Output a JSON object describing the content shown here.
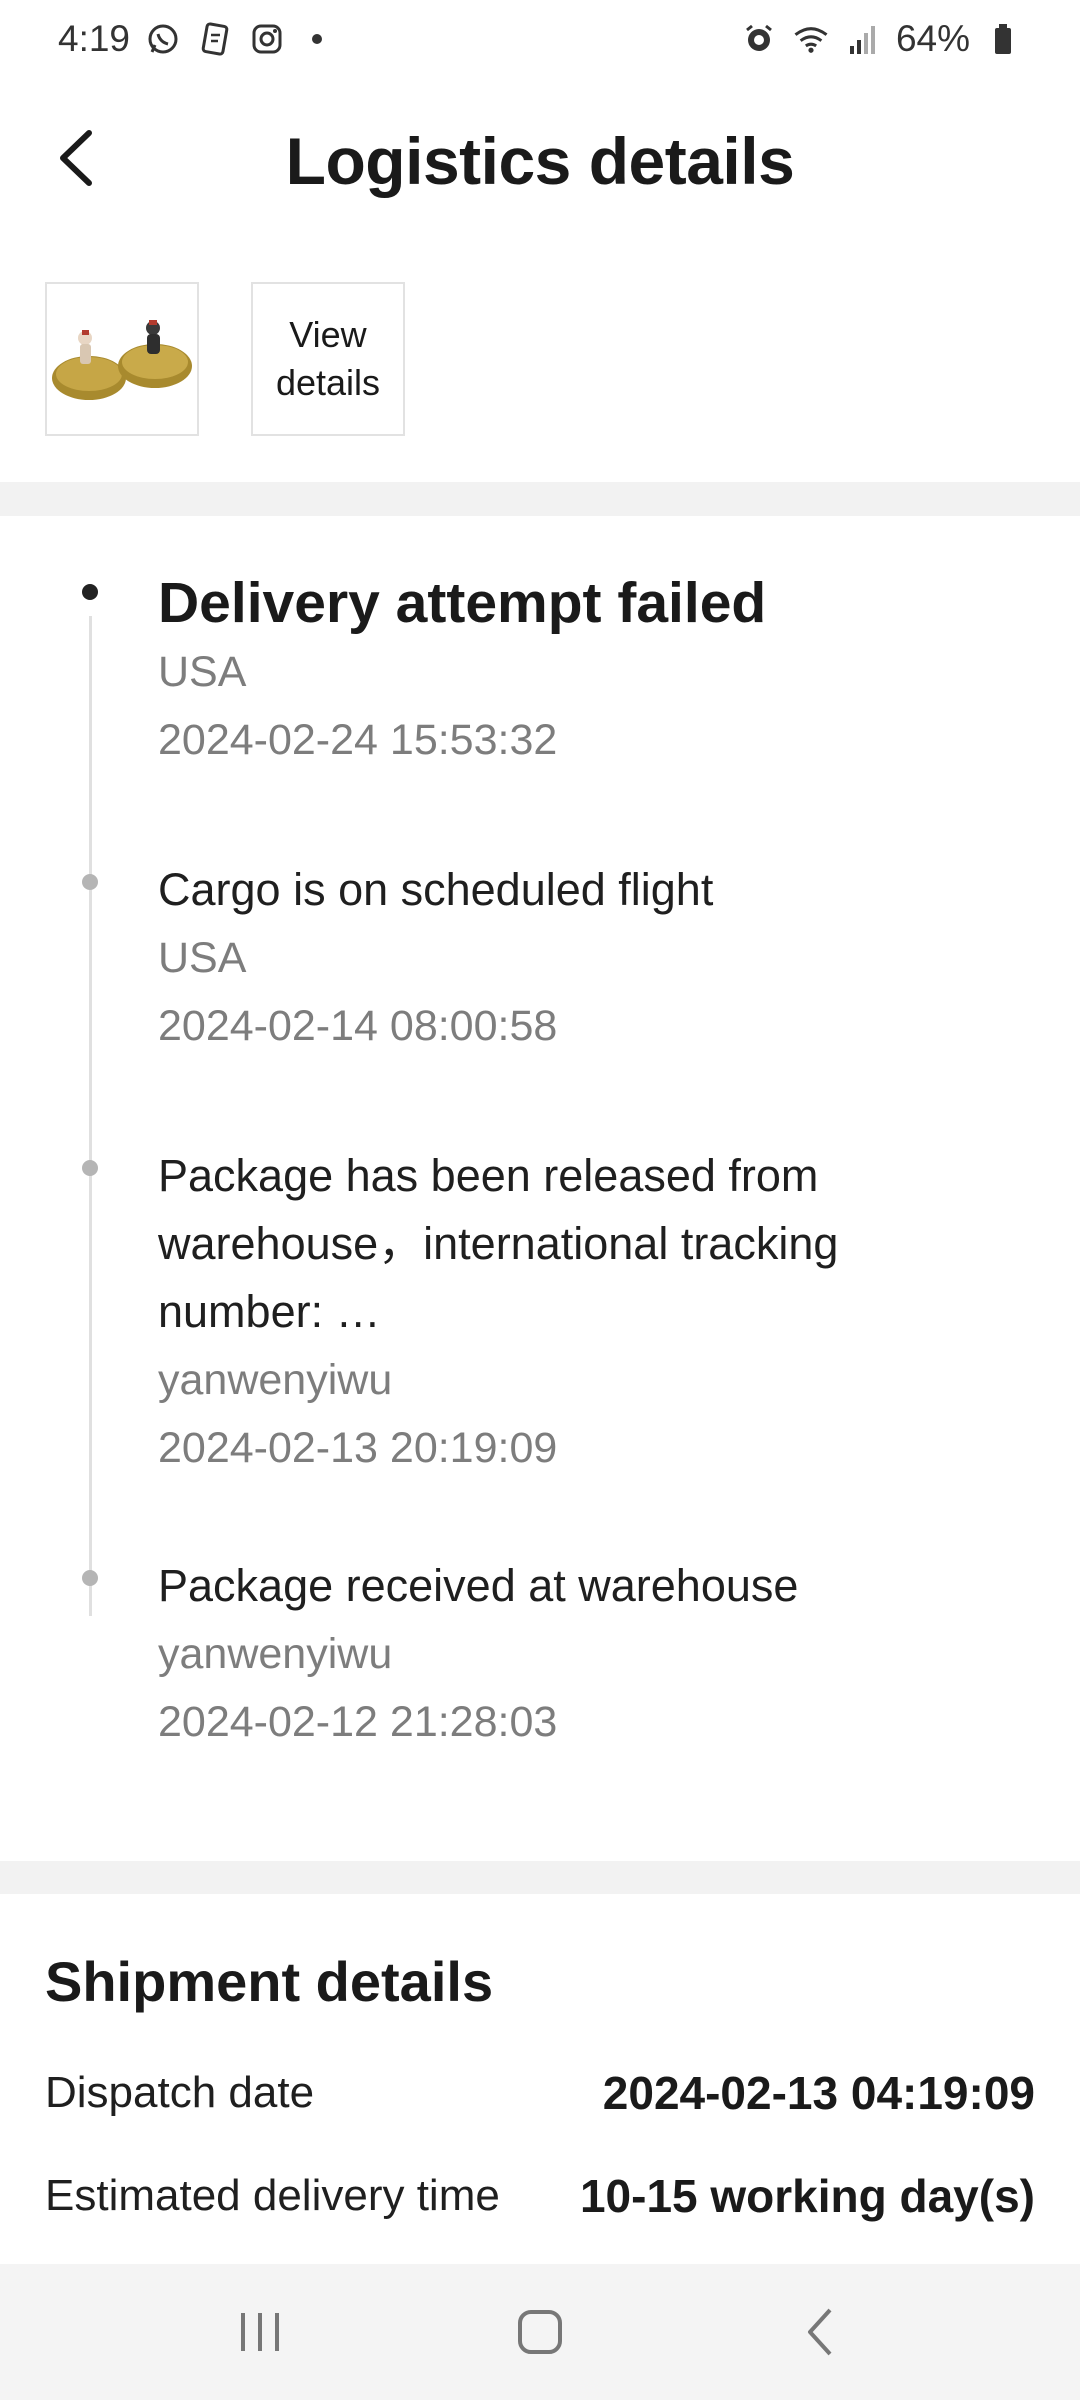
{
  "status_bar": {
    "time": "4:19",
    "battery": "64%",
    "left_icons": [
      "whatsapp-icon",
      "notification-app-icon",
      "instagram-icon"
    ],
    "right_icons": [
      "alarm-icon",
      "wifi-icon",
      "signal-icon",
      "battery-icon"
    ]
  },
  "header": {
    "title": "Logistics details"
  },
  "product": {
    "view_details_label": "View details"
  },
  "timeline": {
    "events": [
      {
        "title": "Delivery attempt failed",
        "location": "USA",
        "time": "2024-02-24 15:53:32",
        "active": true
      },
      {
        "title": "Cargo is on scheduled flight",
        "location": "USA",
        "time": "2024-02-14 08:00:58",
        "active": false
      },
      {
        "title": "Package has been released from warehouse，international tracking number: …",
        "location": "yanwenyiwu",
        "time": "2024-02-13 20:19:09",
        "active": false
      },
      {
        "title": "Package received at warehouse",
        "location": "yanwenyiwu",
        "time": "2024-02-12 21:28:03",
        "active": false
      }
    ]
  },
  "shipment": {
    "title": "Shipment details",
    "rows": [
      {
        "label": "Dispatch date",
        "value": "2024-02-13 04:19:09"
      },
      {
        "label": "Estimated delivery time",
        "value": "10-15 working day(s)"
      }
    ]
  },
  "colors": {
    "background": "#ffffff",
    "divider": "#f2f2f2",
    "secondary_text": "#7d7d7d",
    "timeline_line": "#e0e0e0",
    "nav_bar": "#f4f4f4"
  }
}
